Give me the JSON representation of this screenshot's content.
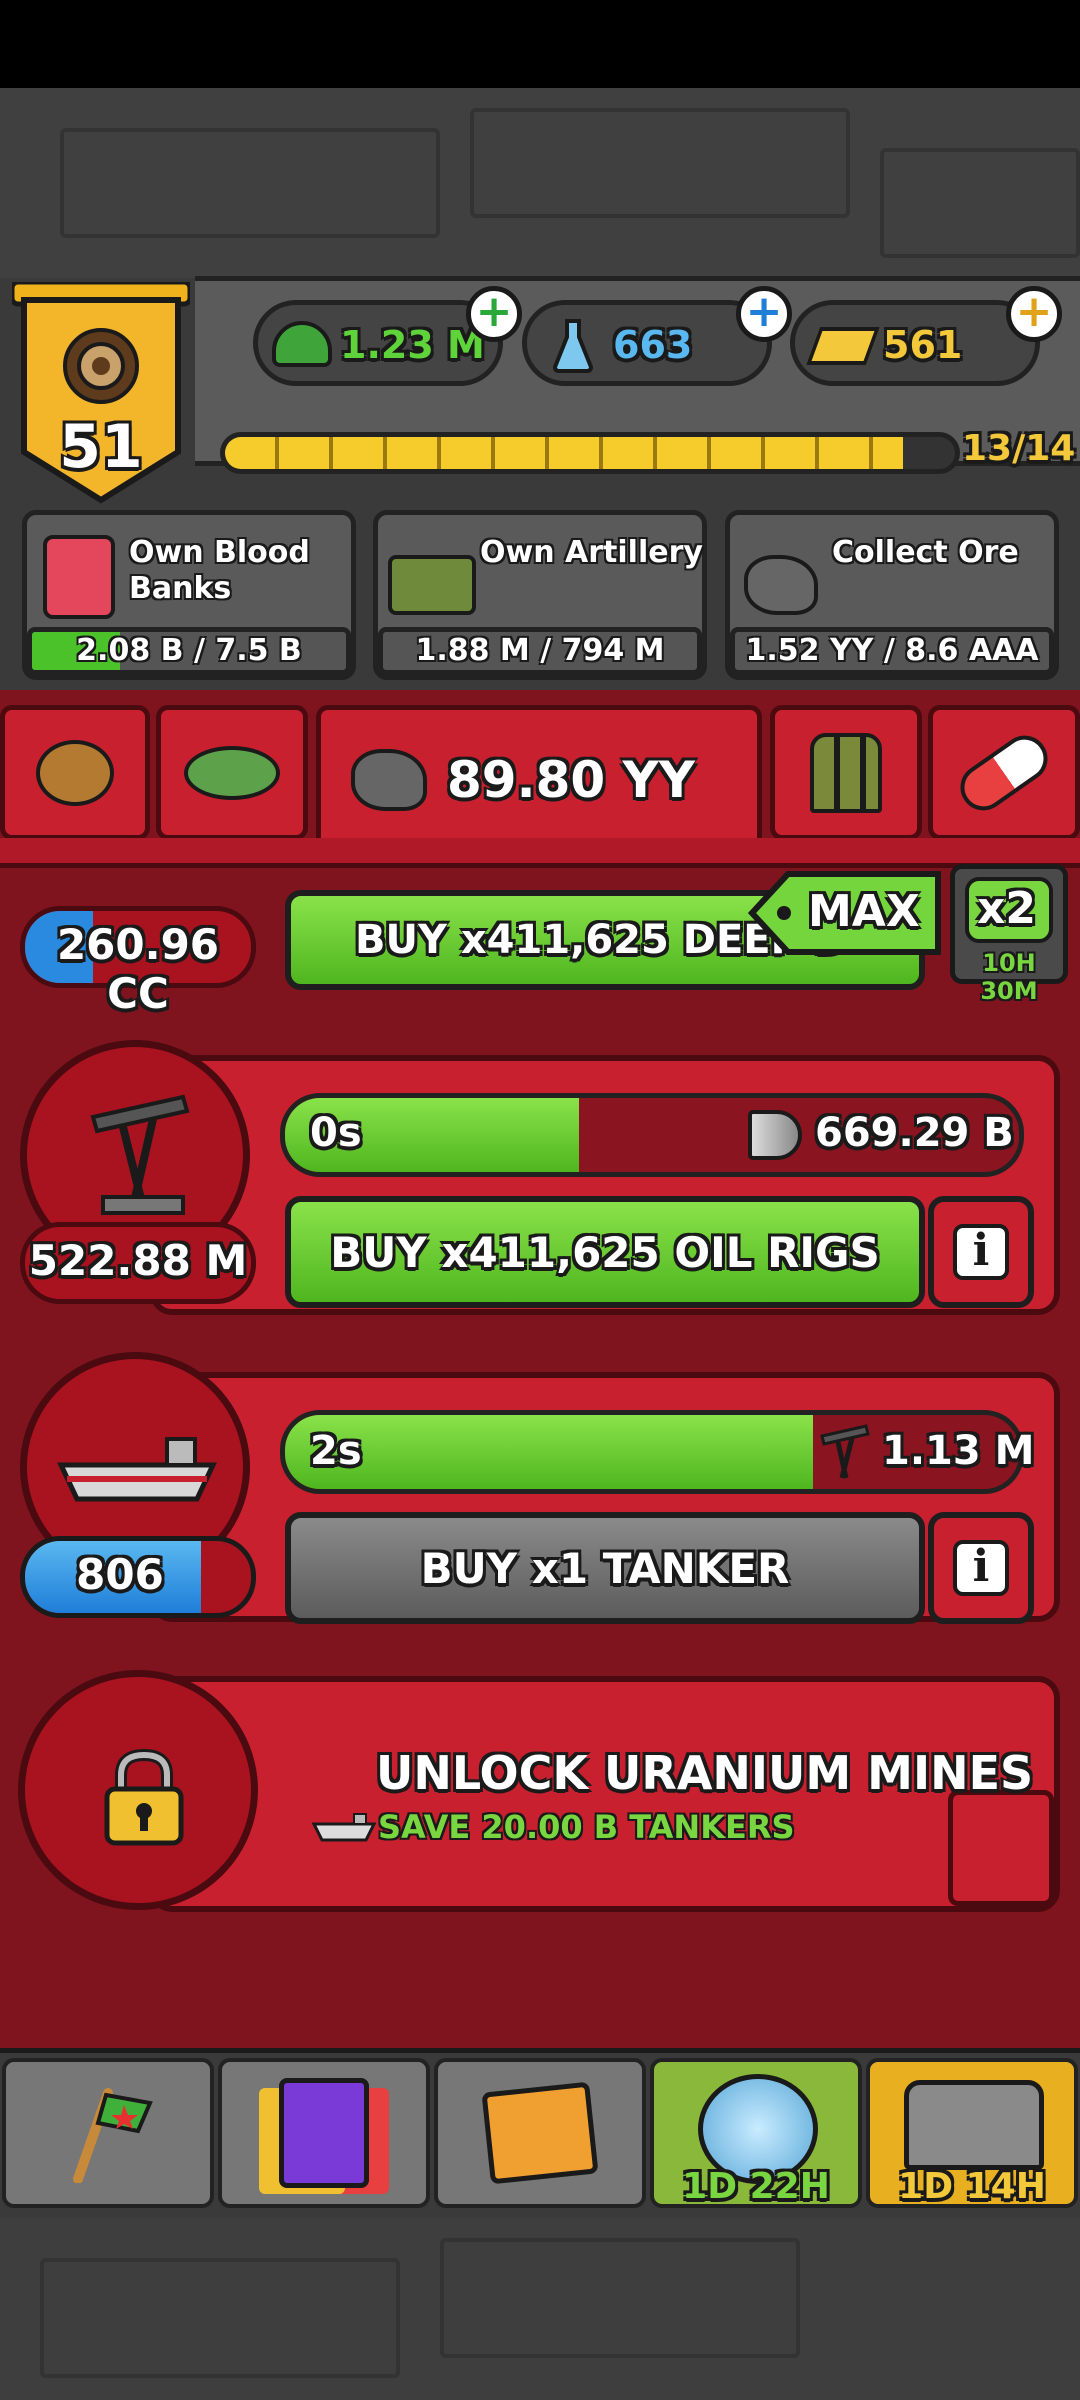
{
  "level": {
    "value": "51"
  },
  "currencies": [
    {
      "icon": "army-cap-icon",
      "value": "1.23 M",
      "color": "#5fd33a"
    },
    {
      "icon": "flask-icon",
      "value": "663",
      "color": "#5ab8f0"
    },
    {
      "icon": "gold-bars-icon",
      "value": "561",
      "color": "#f3c83a"
    }
  ],
  "progress": {
    "label": "13/14",
    "fraction": 0.929
  },
  "missions": [
    {
      "icon": "blood-bank-icon",
      "title": "Own Blood Banks",
      "progress": "2.08 B / 7.5 B",
      "fraction": 0.28
    },
    {
      "icon": "artillery-icon",
      "title": "Own Artillery",
      "progress": "1.88 M / 794 M",
      "fraction": 0.0
    },
    {
      "icon": "ore-icon",
      "title": "Collect Ore",
      "progress": "1.52 YY / 8.6 AAA",
      "fraction": 0.0
    }
  ],
  "resource_tabs": {
    "active_value": "89.80 YY",
    "tabs": [
      "potato-icon",
      "oil-field-icon",
      "ore-icon",
      "ammo-icon",
      "pill-icon"
    ]
  },
  "max_button": {
    "label": "MAX"
  },
  "multiplier": {
    "label": "x2",
    "timer": "10H 30M"
  },
  "producers": [
    {
      "name": "deep-drill",
      "count": "260.96 CC",
      "buy_label": "BUY x411,625 DEEP D"
    },
    {
      "name": "oil-rigs",
      "count": "522.88 M",
      "timer": "0s",
      "yield": "669.29 B",
      "bar_fraction": 0.4,
      "buy_label": "BUY x411,625 OIL RIGS",
      "buy_enabled": true
    },
    {
      "name": "tanker",
      "count": "806",
      "count_fraction": 0.78,
      "timer": "2s",
      "yield": "1.13 M",
      "bar_fraction": 0.72,
      "buy_label": "BUY x1 TANKER",
      "buy_enabled": false
    }
  ],
  "unlock": {
    "title": "UNLOCK URANIUM MINES",
    "subtitle": "SAVE 20.00 B TANKERS"
  },
  "bottom_nav": [
    {
      "icon": "flag-icon",
      "timer": ""
    },
    {
      "icon": "cards-icon",
      "timer": ""
    },
    {
      "icon": "folder-icon",
      "timer": ""
    },
    {
      "icon": "zombie-hand-icon",
      "timer": "1D 22H"
    },
    {
      "icon": "treasure-chest-icon",
      "timer": "1D 14H"
    }
  ]
}
